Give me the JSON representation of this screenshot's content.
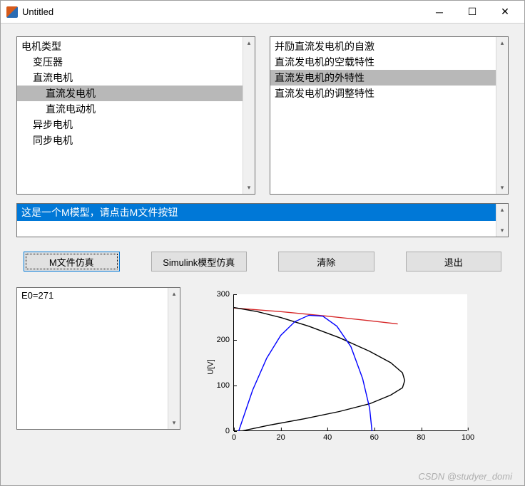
{
  "window": {
    "title": "Untitled"
  },
  "tree": {
    "items": [
      {
        "label": "电机类型",
        "indent": 0,
        "selected": false
      },
      {
        "label": "变压器",
        "indent": 1,
        "selected": false
      },
      {
        "label": "直流电机",
        "indent": 1,
        "selected": false
      },
      {
        "label": "直流发电机",
        "indent": 2,
        "selected": true
      },
      {
        "label": "直流电动机",
        "indent": 2,
        "selected": false
      },
      {
        "label": "异步电机",
        "indent": 1,
        "selected": false
      },
      {
        "label": "同步电机",
        "indent": 1,
        "selected": false
      }
    ]
  },
  "options": {
    "items": [
      {
        "label": "并励直流发电机的自激",
        "selected": false
      },
      {
        "label": "直流发电机的空载特性",
        "selected": false
      },
      {
        "label": "直流发电机的外特性",
        "selected": true
      },
      {
        "label": "直流发电机的调整特性",
        "selected": false
      }
    ]
  },
  "info": {
    "text": "这是一个M模型，请点击M文件按钮",
    "highlighted": true
  },
  "buttons": {
    "mfile": "M文件仿真",
    "simulink": "Simulink模型仿真",
    "clear": "清除",
    "exit": "退出"
  },
  "result": {
    "text": "E0=271"
  },
  "chart_data": {
    "type": "line",
    "ylabel": "U[V]",
    "xlim": [
      0,
      100
    ],
    "ylim": [
      0,
      300
    ],
    "xticks": [
      0,
      20,
      40,
      60,
      80,
      100
    ],
    "yticks": [
      0,
      100,
      200,
      300
    ],
    "series": [
      {
        "name": "red",
        "color": "#d62728",
        "x": [
          0,
          20,
          40,
          60,
          70
        ],
        "y": [
          270,
          262,
          252,
          241,
          235
        ]
      },
      {
        "name": "black",
        "color": "#000000",
        "x": [
          0,
          10,
          20,
          32,
          45,
          58,
          67,
          72,
          73,
          72,
          67,
          58,
          45,
          30,
          15,
          3
        ],
        "y": [
          271,
          262,
          249,
          230,
          205,
          175,
          150,
          128,
          111,
          95,
          79,
          60,
          43,
          27,
          13,
          0
        ]
      },
      {
        "name": "blue",
        "color": "#0000ff",
        "x": [
          2,
          8,
          14,
          20,
          26,
          32,
          38,
          44,
          50,
          55,
          58,
          59
        ],
        "y": [
          0,
          90,
          160,
          210,
          240,
          254,
          252,
          230,
          185,
          115,
          50,
          0
        ]
      }
    ]
  },
  "watermark": "CSDN @studyer_domi"
}
